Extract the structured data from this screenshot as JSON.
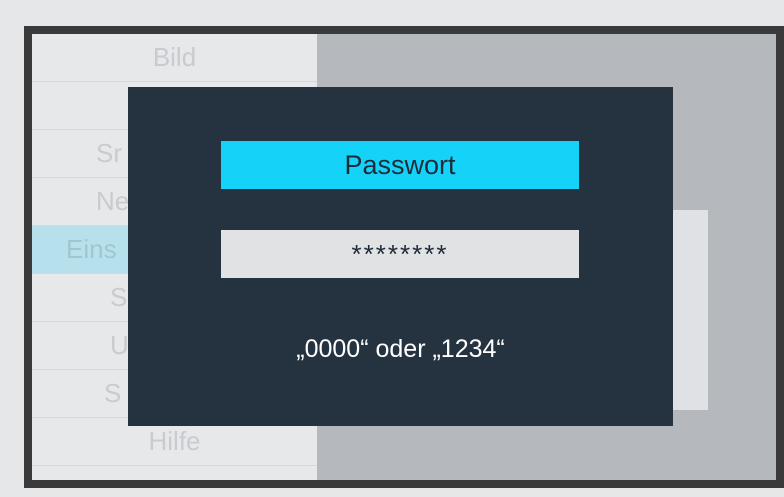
{
  "menu": {
    "items": [
      {
        "label": "Bild"
      },
      {
        "label": ""
      },
      {
        "label": "Sr"
      },
      {
        "label": "Ne"
      },
      {
        "label": "Eins"
      },
      {
        "label": "S"
      },
      {
        "label": "U"
      },
      {
        "label": "S"
      },
      {
        "label": "Hilfe"
      }
    ],
    "active_index": 4
  },
  "dialog": {
    "title": "Passwort",
    "password_value": "********",
    "hint": "„0000“ oder „1234“"
  },
  "colors": {
    "accent": "#15d2f9",
    "dialog_bg": "#253341",
    "frame": "#3a3a3a"
  }
}
